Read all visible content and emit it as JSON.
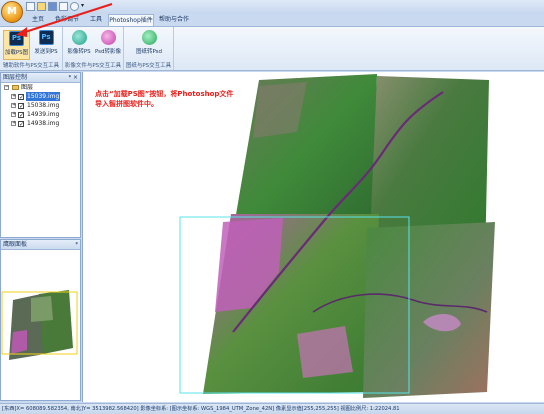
{
  "window": {
    "app_logo_letter": "M"
  },
  "ribbon": {
    "tabs": [
      {
        "label": "主页",
        "active": false
      },
      {
        "label": "色彩调节",
        "active": false
      },
      {
        "label": "工具",
        "active": false
      },
      {
        "label": "Photoshop插件",
        "active": true
      },
      {
        "label": "帮助与合作",
        "active": false
      }
    ],
    "groups": [
      {
        "caption": "辅助软件与PS交互工具",
        "buttons": [
          {
            "label": "加载PS图",
            "icon": "photoshop-icon",
            "highlighted": true
          },
          {
            "label": "发送到PS",
            "icon": "photoshop-send-icon",
            "highlighted": false
          }
        ]
      },
      {
        "caption": "影像文件与PS交互工具",
        "buttons": [
          {
            "label": "影像转PS",
            "icon": "image-to-ps-icon",
            "highlighted": false
          },
          {
            "label": "Psd转影像",
            "icon": "psd-to-image-icon",
            "highlighted": false
          }
        ]
      },
      {
        "caption": "图纸与PS交互工具",
        "buttons": [
          {
            "label": "图纸转Psd",
            "icon": "drawing-to-psd-icon",
            "highlighted": false
          }
        ]
      }
    ]
  },
  "layer_panel": {
    "title": "图层控制",
    "pin": "ᵠ ×",
    "root_label": "图层",
    "layers": [
      {
        "name": "15039.img",
        "checked": true,
        "selected": true
      },
      {
        "name": "15038.img",
        "checked": true,
        "selected": false
      },
      {
        "name": "14939.img",
        "checked": true,
        "selected": false
      },
      {
        "name": "14938.img",
        "checked": true,
        "selected": false
      }
    ]
  },
  "eagle_panel": {
    "title": "鹰眼面板",
    "pin": "ᵠ"
  },
  "map": {
    "annotation_line1": "点击“加载PS图”按钮，将Photoshop文件",
    "annotation_line2": "导入智拼图软件中。",
    "annotation_color": "#e8201c",
    "view_rect_color": "#58e3ea"
  },
  "status_bar": {
    "text": "[东西]X= 608089.582354, 南北]Y= 3513982.568420] 影像坐标系: [图示坐标系: WGS_1984_UTM_Zone_42N] 像素显示值[255,255,255] 视图比例尺: 1:22024.81"
  },
  "colors": {
    "ribbon_bg": "#f4f8fd",
    "selection": "#3376d6",
    "panel_border": "#8ea9cf"
  }
}
